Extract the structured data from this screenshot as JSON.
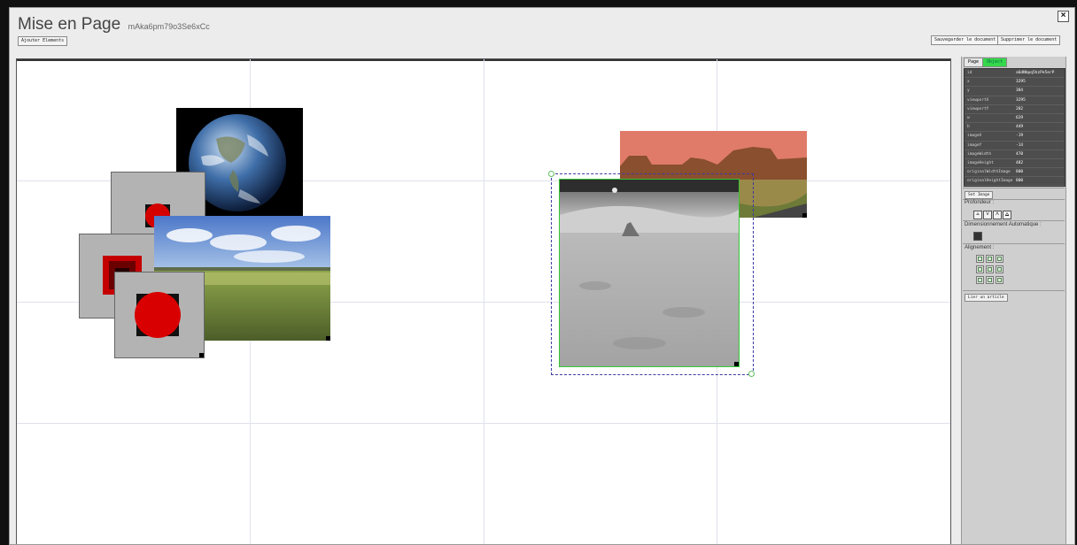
{
  "window": {
    "close_label": "×"
  },
  "header": {
    "title": "Mise en Page",
    "doc_id": "mAka6pm79o3Se6xCc",
    "add_elements_label": "Ajouter Elements",
    "save_label": "Sauvegarder le document",
    "delete_label": "Supprimer le document"
  },
  "canvas": {
    "images": [
      {
        "name": "earth-photo",
        "description": "earth"
      },
      {
        "name": "red-circle-image-1",
        "description": "red circle small"
      },
      {
        "name": "red-square-blurred-image",
        "description": "blurred red"
      },
      {
        "name": "field-landscape-photo",
        "description": "grass field"
      },
      {
        "name": "red-circle-image-2",
        "description": "red circle"
      },
      {
        "name": "desert-landscape-photo",
        "description": "desert"
      },
      {
        "name": "moon-surface-photo",
        "description": "moon, selected"
      }
    ]
  },
  "panel": {
    "tabs": [
      "Page",
      "Object"
    ],
    "active_tab": "Object",
    "properties": [
      {
        "key": "id",
        "value": "a6dNbpq5hzPe5erP"
      },
      {
        "key": "x",
        "value": "3295"
      },
      {
        "key": "y",
        "value": "384"
      },
      {
        "key": "viewportX",
        "value": "3295"
      },
      {
        "key": "viewportY",
        "value": "282"
      },
      {
        "key": "w",
        "value": "629"
      },
      {
        "key": "h",
        "value": "449"
      },
      {
        "key": "imageX",
        "value": "-19"
      },
      {
        "key": "imageY",
        "value": "-14"
      },
      {
        "key": "imageWidth",
        "value": "470"
      },
      {
        "key": "imageHeight",
        "value": "482"
      },
      {
        "key": "originalWidthImage",
        "value": "800"
      },
      {
        "key": "originalHeightImage",
        "value": "800"
      }
    ],
    "set_image_label": "Set Image",
    "depth_label": "Profondeur :",
    "depth_buttons": [
      "⩡",
      "˅",
      "˄",
      "⩠"
    ],
    "auto_size_label": "Dimensionnement Automatique :",
    "alignment_label": "Alignement :",
    "link_article_label": "Lier un article"
  },
  "colors": {
    "accent_green": "#36d94c",
    "selection_blue": "#3a3aa0"
  }
}
